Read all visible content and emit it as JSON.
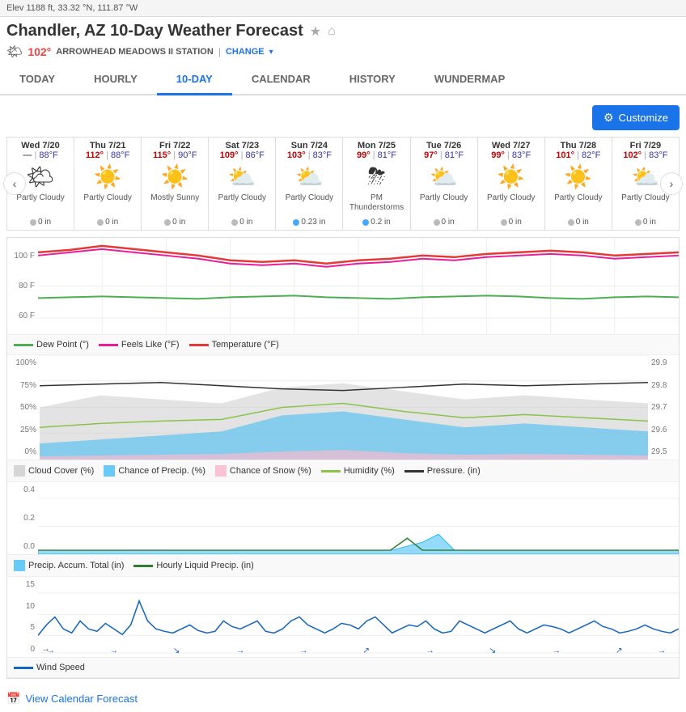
{
  "page": {
    "elevation": "Elev 1188 ft, 33.32 °N, 111.87 °W",
    "title": "Chandler, AZ 10-Day Weather Forecast",
    "station_temp": "102°",
    "station_name": "ARROWHEAD MEADOWS II STATION",
    "change_label": "CHANGE",
    "tabs": [
      "TODAY",
      "HOURLY",
      "10-DAY",
      "CALENDAR",
      "HISTORY",
      "WUNDERMAP"
    ],
    "active_tab": "10-DAY",
    "customize_label": "Customize",
    "days": [
      {
        "label": "Wed 7/20",
        "hi": "—",
        "lo": "88°F",
        "icon": "🌤",
        "desc": "Partly Cloudy",
        "precip": "0 in",
        "precip_type": "gray"
      },
      {
        "label": "Thu 7/21",
        "hi": "112°",
        "lo": "88°F",
        "icon": "☀️",
        "desc": "Partly Cloudy",
        "precip": "0 in",
        "precip_type": "gray"
      },
      {
        "label": "Fri 7/22",
        "hi": "115°",
        "lo": "90°F",
        "icon": "☀️",
        "desc": "Mostly Sunny",
        "precip": "0 in",
        "precip_type": "gray"
      },
      {
        "label": "Sat 7/23",
        "hi": "109°",
        "lo": "86°F",
        "icon": "⛅",
        "desc": "Partly Cloudy",
        "precip": "0 in",
        "precip_type": "gray"
      },
      {
        "label": "Sun 7/24",
        "hi": "103°",
        "lo": "83°F",
        "icon": "⛅",
        "desc": "Partly Cloudy",
        "precip": "0.23 in",
        "precip_type": "blue"
      },
      {
        "label": "Mon 7/25",
        "hi": "99°",
        "lo": "81°F",
        "icon": "⛈",
        "desc": "PM Thunderstorms",
        "precip": "0.2 in",
        "precip_type": "blue"
      },
      {
        "label": "Tue 7/26",
        "hi": "97°",
        "lo": "81°F",
        "icon": "⛅",
        "desc": "Partly Cloudy",
        "precip": "0 in",
        "precip_type": "gray"
      },
      {
        "label": "Wed 7/27",
        "hi": "99°",
        "lo": "83°F",
        "icon": "☀️",
        "desc": "Partly Cloudy",
        "precip": "0 in",
        "precip_type": "gray"
      },
      {
        "label": "Thu 7/28",
        "hi": "101°",
        "lo": "82°F",
        "icon": "☀️",
        "desc": "Partly Cloudy",
        "precip": "0 in",
        "precip_type": "gray"
      },
      {
        "label": "Fri 7/29",
        "hi": "102°",
        "lo": "83°F",
        "icon": "⛅",
        "desc": "Partly Cloudy",
        "precip": "0 in",
        "precip_type": "gray"
      }
    ],
    "chart1": {
      "y_labels": [
        "100 F",
        "80 F",
        "60 F"
      ],
      "legend": [
        {
          "label": "Dew Point (°)",
          "color": "#4caf50",
          "type": "line"
        },
        {
          "label": "Feels Like (°F)",
          "color": "#e91e96",
          "type": "line"
        },
        {
          "label": "Temperature (°F)",
          "color": "#e53935",
          "type": "line"
        }
      ]
    },
    "chart2": {
      "y_labels_left": [
        "100%",
        "75%",
        "50%",
        "25%",
        "0%"
      ],
      "y_labels_right": [
        "29.9",
        "29.8",
        "29.7",
        "29.6",
        "29.5"
      ],
      "legend": [
        {
          "label": "Cloud Cover (%)",
          "color": "#bbb",
          "type": "area"
        },
        {
          "label": "Chance of Precip. (%)",
          "color": "#29b6f6",
          "type": "area"
        },
        {
          "label": "Chance of Snow (%)",
          "color": "#f8bbd0",
          "type": "area"
        },
        {
          "label": "Humidity (%)",
          "color": "#8bc34a",
          "type": "line"
        },
        {
          "label": "Pressure. (in)",
          "color": "#333",
          "type": "line"
        }
      ]
    },
    "chart3": {
      "y_labels": [
        "0.4",
        "0.2",
        "0.0"
      ],
      "legend": [
        {
          "label": "Precip. Accum. Total (in)",
          "color": "#29b6f6",
          "type": "area"
        },
        {
          "label": "Hourly Liquid Precip. (in)",
          "color": "#2e7d32",
          "type": "line"
        }
      ]
    },
    "chart4": {
      "y_labels": [
        "15",
        "10",
        "5",
        "0"
      ],
      "legend": [
        {
          "label": "Wind Speed",
          "color": "#1565c0",
          "type": "line"
        }
      ],
      "arrow_label": "→"
    },
    "footer": {
      "link": "View Calendar Forecast"
    }
  }
}
